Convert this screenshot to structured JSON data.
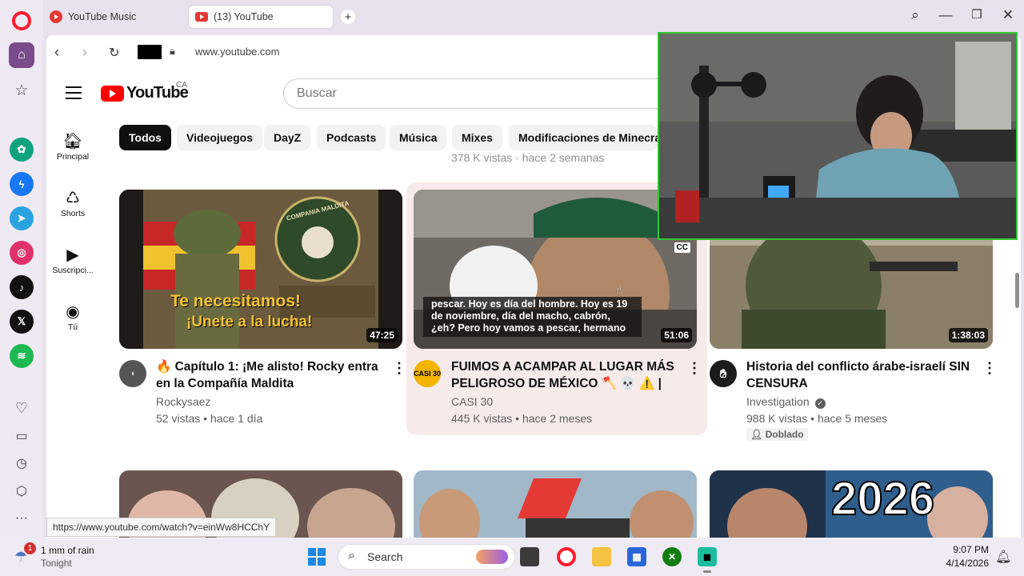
{
  "browser": {
    "tabs": [
      {
        "label": "YouTube Music"
      },
      {
        "label": "(13) YouTube"
      }
    ],
    "new_tab_symbol": "+",
    "address": "www.youtube.com",
    "hover_url": "https://www.youtube.com/watch?v=einWw8HCChY"
  },
  "youtube": {
    "logo_text": "YouTube",
    "region": "CA",
    "search_placeholder": "Buscar",
    "nav": [
      {
        "label": "Principal",
        "icon": "home-icon"
      },
      {
        "label": "Shorts",
        "icon": "shorts-icon"
      },
      {
        "label": "Suscripci...",
        "icon": "subscriptions-icon"
      },
      {
        "label": "Tú",
        "icon": "you-icon"
      }
    ],
    "chips": [
      "Todos",
      "Videojuegos",
      "DayZ",
      "Podcasts",
      "Música",
      "Mixes",
      "Modificaciones de Minecraft"
    ],
    "faded_row_text": "378 K vistas · hace 2 semanas",
    "videos": [
      {
        "thumb_title": "Te necesitamos!",
        "thumb_subtitle": "¡Unete a la lucha!",
        "thumb_emblem": "COMPANIA MALDITA",
        "duration": "47:25",
        "title": "🔥 Capítulo 1: ¡Me alisto! Rocky entra en la Compañía Maldita",
        "channel": "Rockysaez",
        "meta": "52 vistas • hace 1 día"
      },
      {
        "cc": "CC",
        "caption": "pescar. Hoy es día del hombre. Hoy es 19 de noviembre, día del macho, cabrón, ¿eh? Pero hoy vamos a pescar, hermano",
        "duration": "51:06",
        "title": "FUIMOS A ACAMPAR AL LUGAR MÁS PELIGROSO DE MÉXICO 🪓 💀 ⚠️ | CAS...",
        "channel_avatar": "CASI 30",
        "channel": "CASI 30",
        "meta": "445 K vistas • hace 2 meses"
      },
      {
        "duration": "1:38:03",
        "title": "Historia del conflicto árabe-israelí SIN CENSURA",
        "channel": "Investigation",
        "verified": true,
        "meta": "988 K vistas • hace 5 meses",
        "badge": "Doblado"
      }
    ],
    "row2_text": "2026"
  },
  "taskbar": {
    "weather_badge": "1",
    "weather_line1": "1 mm of rain",
    "weather_line2": "Tonight",
    "search_label": "Search",
    "time": "9:07 PM",
    "date": "4/14/2026"
  },
  "colors": {
    "yt_red": "#ff0000",
    "opera_red": "#ff1b2d",
    "hover_card": "#f7ebe9",
    "webcam_border": "#2fc832"
  }
}
